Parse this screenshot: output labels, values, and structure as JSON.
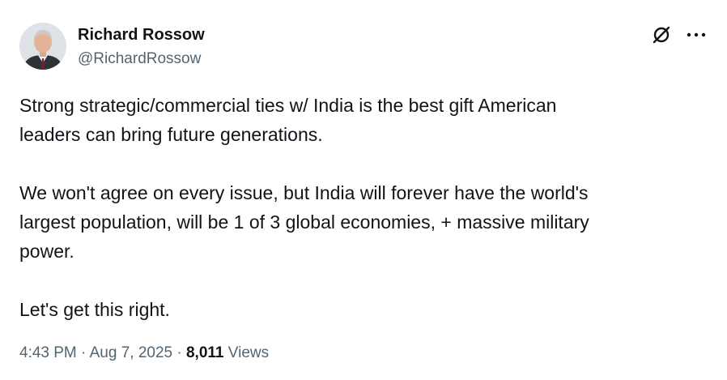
{
  "author": {
    "name": "Richard Rossow",
    "handle": "@RichardRossow"
  },
  "icons": {
    "grok": "grok-icon",
    "more": "more-icon",
    "avatar": "avatar"
  },
  "tweet": {
    "paragraphs": [
      "Strong strategic/commercial ties w/ India is the best gift American\nleaders can bring future generations.",
      "We won't agree on every issue, but India will forever have the world's\nlargest population, will be 1 of 3 global economies, + massive military\npower.",
      "Let's get this right."
    ]
  },
  "meta": {
    "time": "4:43 PM",
    "separator": "·",
    "date": "Aug 7, 2025",
    "views_count": "8,011",
    "views_label": "Views"
  },
  "colors": {
    "text_primary": "#0f1419",
    "text_secondary": "#536471",
    "background": "#ffffff"
  }
}
